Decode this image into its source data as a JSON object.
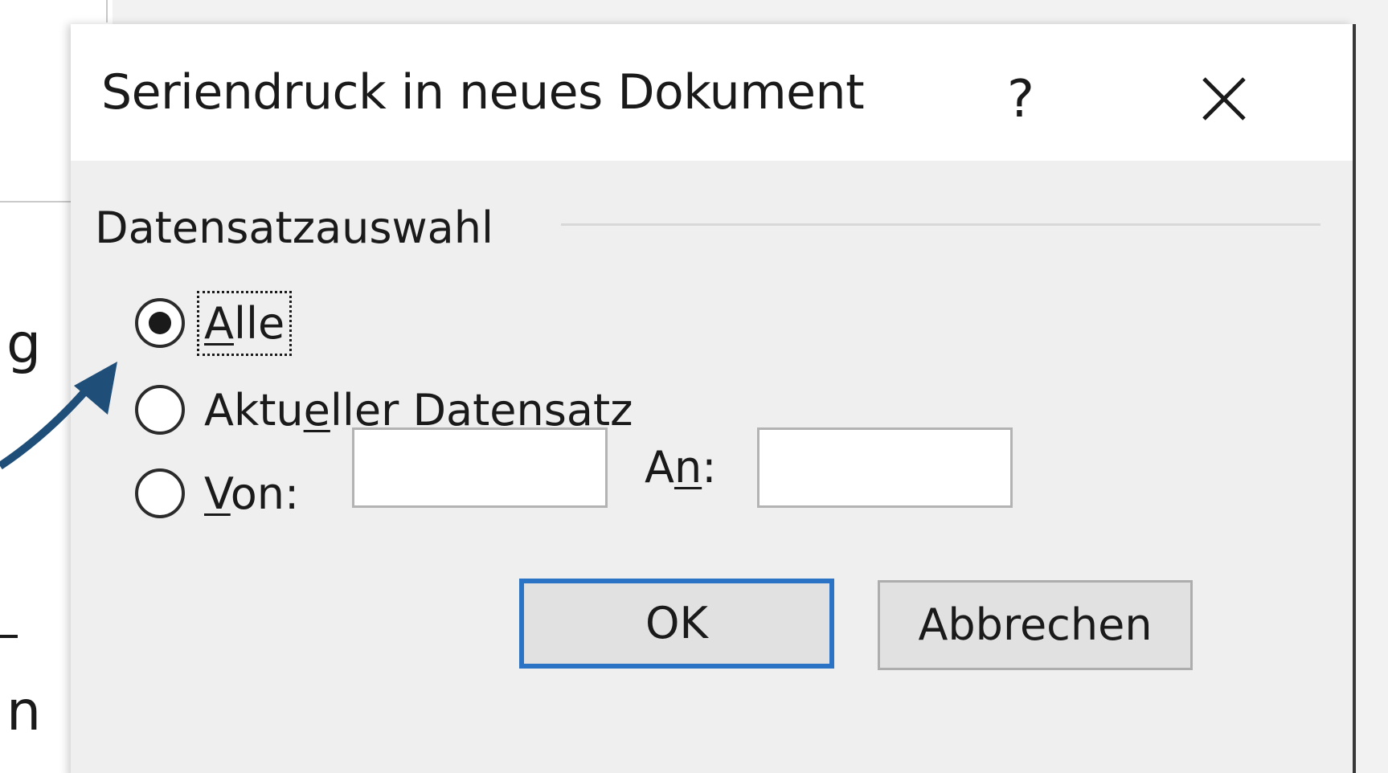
{
  "dialog": {
    "title": "Seriendruck in neues Dokument",
    "help_glyph": "?",
    "close_icon": "close-icon"
  },
  "record_selection": {
    "group_label": "Datensatzauswahl",
    "options": [
      {
        "label_pre": "",
        "label_mnemonic": "A",
        "label_post": "lle",
        "checked": true
      },
      {
        "label_pre": "Aktu",
        "label_mnemonic": "e",
        "label_post": "ller Datensatz",
        "checked": false
      },
      {
        "label_pre": "",
        "label_mnemonic": "V",
        "label_post": "on:",
        "checked": false
      }
    ],
    "from_value": "",
    "to_label_pre": "A",
    "to_label_mnemonic": "n",
    "to_label_post": ":",
    "to_value": ""
  },
  "buttons": {
    "ok_label": "OK",
    "cancel_label": "Abbrechen"
  },
  "background": {
    "glyph_1": "g",
    "glyph_2": "n",
    "arrow_color": "#1f4e79"
  },
  "colors": {
    "default_button_border": "#2b73c4",
    "dialog_bg": "#efefef"
  }
}
